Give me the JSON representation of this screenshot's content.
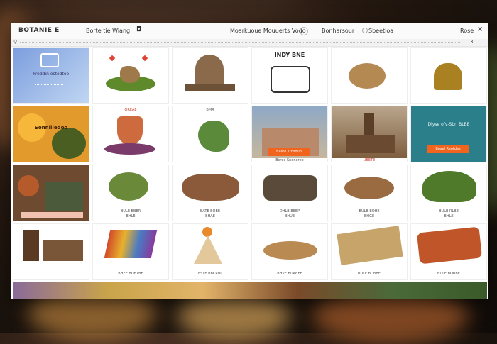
{
  "header": {
    "brand": "BOTANIE E",
    "nav_left": "Borte tie Wiang",
    "nav_center": "Moarkuoue Mouuerts Vodo",
    "nav_right_1": "Bonharsour",
    "nav_right_2": "Sbeetloa",
    "user_menu": "Rose",
    "page_count": "3"
  },
  "colors": {
    "accent": "#f0641e",
    "teal": "#2a7f8a"
  },
  "tiles": [
    {
      "id": "t0",
      "heading": "Froddin ostodtoo",
      "caption": ""
    },
    {
      "id": "t1",
      "heading": "",
      "caption": ""
    },
    {
      "id": "t2",
      "heading": "",
      "caption": ""
    },
    {
      "id": "t3",
      "heading": "INDY BNE",
      "caption": ""
    },
    {
      "id": "t4",
      "heading": "",
      "caption": ""
    },
    {
      "id": "t5",
      "heading": "",
      "caption": ""
    },
    {
      "id": "t6",
      "heading": "Sonnilledoo",
      "caption": ""
    },
    {
      "id": "t7",
      "heading": "",
      "caption": "OREAE"
    },
    {
      "id": "t8",
      "heading": "",
      "caption": "BMR"
    },
    {
      "id": "t9",
      "heading": "",
      "caption": "Bsree Snoneree",
      "cta": "Baste Ttosouo"
    },
    {
      "id": "t10",
      "heading": "",
      "caption": "UBETE"
    },
    {
      "id": "t11",
      "heading": "Dlyse ofv-Sbrl BLBE",
      "caption": "",
      "cta": "Bosel Reotdes"
    },
    {
      "id": "t12",
      "heading": "",
      "caption": ""
    },
    {
      "id": "t13",
      "heading": "",
      "caption": "BULE BBER",
      "caption2": "BHLE"
    },
    {
      "id": "t14",
      "heading": "",
      "caption": "BATE BOBE",
      "caption2": "BHAE"
    },
    {
      "id": "t15",
      "heading": "",
      "caption": "DHLB BEEP",
      "caption2": "BHUE"
    },
    {
      "id": "t16",
      "heading": "",
      "caption": "BULB BOHE",
      "caption2": "BHGE"
    },
    {
      "id": "t17",
      "heading": "",
      "caption": "BULB RLBE",
      "caption2": "BHLE"
    },
    {
      "id": "t18",
      "heading": "",
      "caption": ""
    },
    {
      "id": "t19",
      "heading": "",
      "caption": "BHEE BOBTBE"
    },
    {
      "id": "t20",
      "heading": "",
      "caption": "ESTE BBCRBL"
    },
    {
      "id": "t21",
      "heading": "",
      "caption": "BHVE BUABEE"
    },
    {
      "id": "t22",
      "heading": "",
      "caption": "BULE BOBBE"
    },
    {
      "id": "t23",
      "heading": "",
      "caption": "BULE BOBBE"
    }
  ]
}
